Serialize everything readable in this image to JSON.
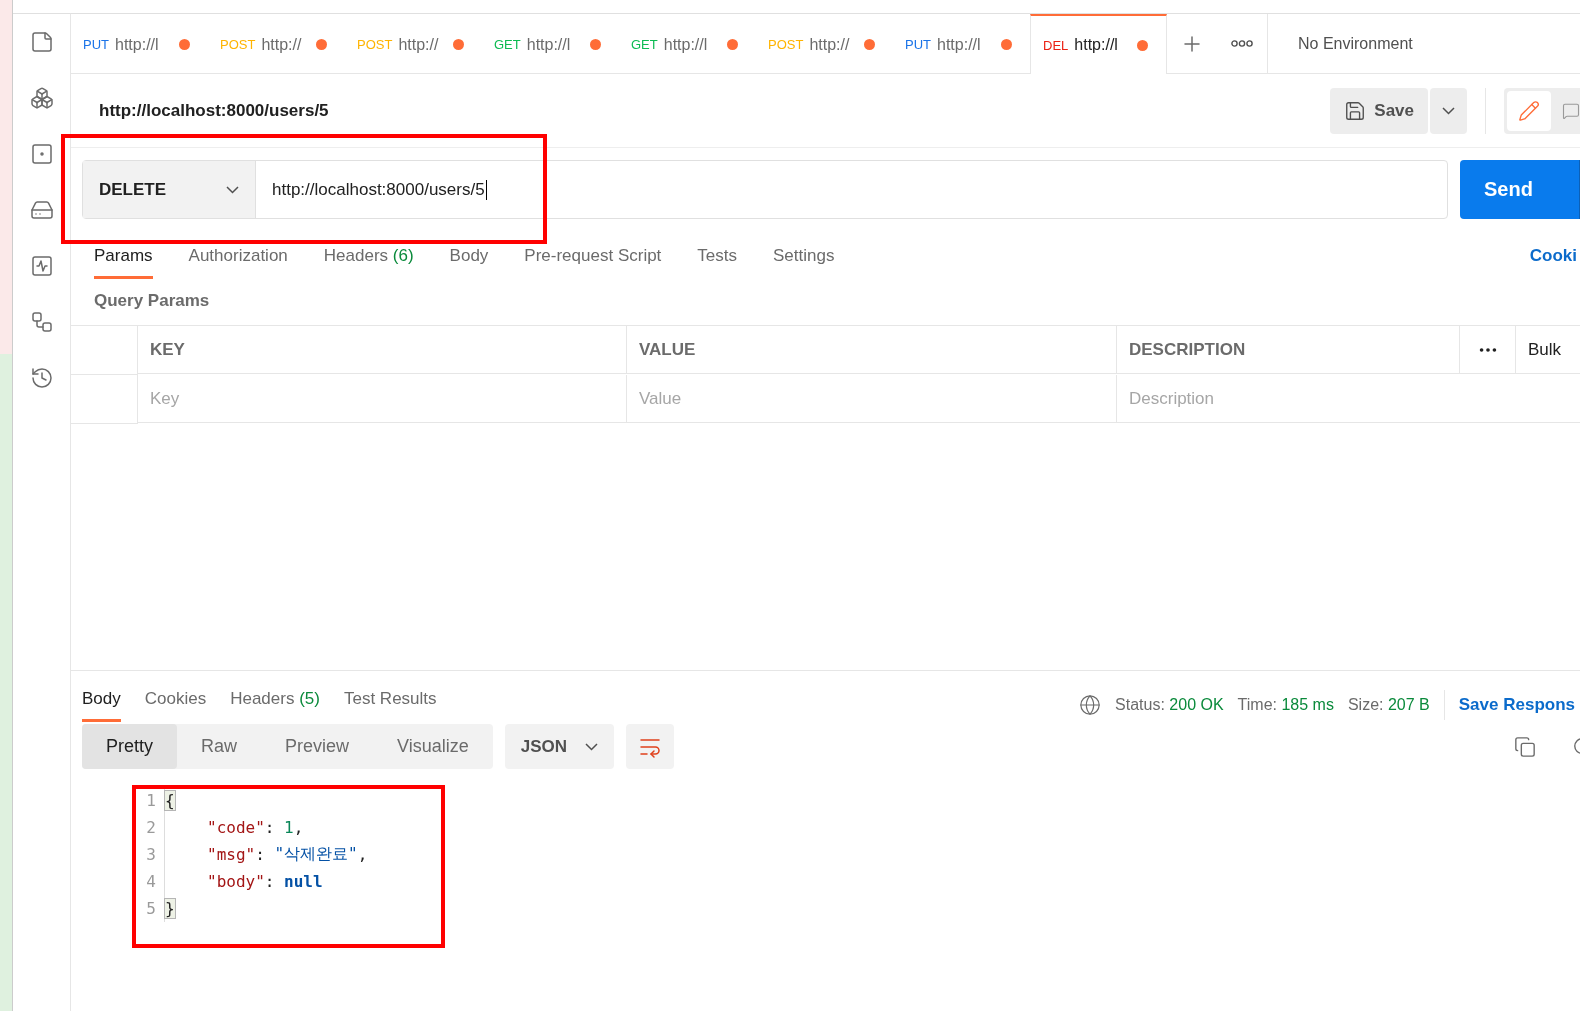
{
  "tabs": [
    {
      "method": "PUT",
      "url": "http://l",
      "color": "#1a73e8",
      "unsaved": true,
      "selected": false
    },
    {
      "method": "POST",
      "url": "http://",
      "color": "#ffb400",
      "unsaved": true,
      "selected": false
    },
    {
      "method": "POST",
      "url": "http://",
      "color": "#ffb400",
      "unsaved": true,
      "selected": false
    },
    {
      "method": "GET",
      "url": "http://l",
      "color": "#0cbb52",
      "unsaved": true,
      "selected": false
    },
    {
      "method": "GET",
      "url": "http://l",
      "color": "#0cbb52",
      "unsaved": true,
      "selected": false
    },
    {
      "method": "POST",
      "url": "http://",
      "color": "#ffb400",
      "unsaved": true,
      "selected": false
    },
    {
      "method": "PUT",
      "url": "http://l",
      "color": "#1a73e8",
      "unsaved": true,
      "selected": false
    },
    {
      "method": "DEL",
      "url": "http://l",
      "color": "#eb2013",
      "unsaved": true,
      "selected": true
    }
  ],
  "environment": "No Environment",
  "request": {
    "title": "http://localhost:8000/users/5",
    "save": "Save",
    "method": "DELETE",
    "url": "http://localhost:8000/users/5",
    "send": "Send"
  },
  "request_tabs": [
    {
      "label": "Params",
      "selected": true
    },
    {
      "label": "Authorization",
      "selected": false
    },
    {
      "label": "Headers",
      "count": "(6)",
      "selected": false
    },
    {
      "label": "Body",
      "selected": false
    },
    {
      "label": "Pre-request Script",
      "selected": false
    },
    {
      "label": "Tests",
      "selected": false
    },
    {
      "label": "Settings",
      "selected": false
    }
  ],
  "cookies_link": "Cooki",
  "query_params": {
    "title": "Query Params",
    "columns": [
      "KEY",
      "VALUE",
      "DESCRIPTION"
    ],
    "bulk": "Bulk",
    "placeholders": [
      "Key",
      "Value",
      "Description"
    ]
  },
  "response_tabs": [
    {
      "label": "Body",
      "selected": true
    },
    {
      "label": "Cookies",
      "selected": false
    },
    {
      "label": "Headers",
      "count": "(5)",
      "selected": false
    },
    {
      "label": "Test Results",
      "selected": false
    }
  ],
  "response_meta": [
    {
      "label": "Status:",
      "value": "200 OK"
    },
    {
      "label": "Time:",
      "value": "185 ms"
    },
    {
      "label": "Size:",
      "value": "207 B"
    }
  ],
  "save_response": "Save Respons",
  "view_modes": [
    {
      "label": "Pretty",
      "selected": true
    },
    {
      "label": "Raw",
      "selected": false
    },
    {
      "label": "Preview",
      "selected": false
    },
    {
      "label": "Visualize",
      "selected": false
    }
  ],
  "format": "JSON",
  "code_lines": [
    {
      "number": "1",
      "tokens": [
        {
          "text": "{",
          "kind": "brace"
        }
      ]
    },
    {
      "number": "2",
      "tokens": [
        {
          "text": "\"code\"",
          "kind": "key"
        },
        {
          "text": ": ",
          "kind": "punct"
        },
        {
          "text": "1",
          "kind": "number"
        },
        {
          "text": ",",
          "kind": "punct"
        }
      ]
    },
    {
      "number": "3",
      "tokens": [
        {
          "text": "\"msg\"",
          "kind": "key"
        },
        {
          "text": ": ",
          "kind": "punct"
        },
        {
          "text": "\"삭제완료\"",
          "kind": "string"
        },
        {
          "text": ",",
          "kind": "punct"
        }
      ]
    },
    {
      "number": "4",
      "tokens": [
        {
          "text": "\"body\"",
          "kind": "key"
        },
        {
          "text": ": ",
          "kind": "punct"
        },
        {
          "text": "null",
          "kind": "null"
        }
      ]
    },
    {
      "number": "5",
      "tokens": [
        {
          "text": "}",
          "kind": "brace"
        }
      ]
    }
  ]
}
